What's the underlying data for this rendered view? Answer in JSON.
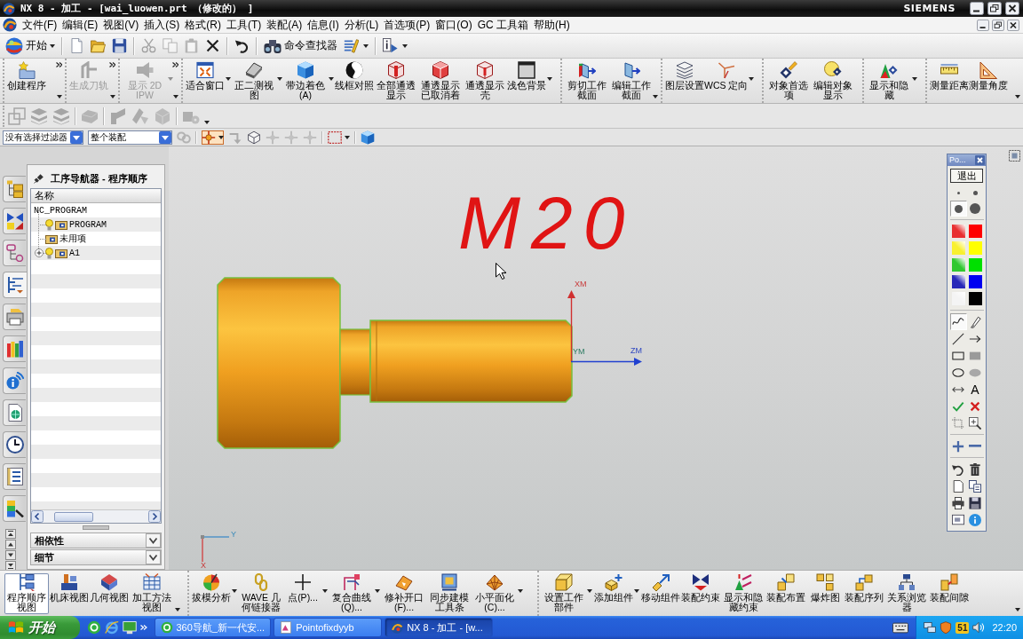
{
  "window": {
    "title": "NX 8 - 加工 - [wai_luowen.prt （修改的） ]",
    "brand": "SIEMENS"
  },
  "menu": [
    "文件(F)",
    "编辑(E)",
    "视图(V)",
    "插入(S)",
    "格式(R)",
    "工具(T)",
    "装配(A)",
    "信息(I)",
    "分析(L)",
    "首选项(P)",
    "窗口(O)",
    "GC 工具箱",
    "帮助(H)"
  ],
  "standard_toolbar": {
    "start": "开始",
    "command_finder": "命令查找器",
    "buttons": [
      {
        "disabled": false,
        "dropdown": false
      },
      {
        "disabled": false,
        "dropdown": false
      },
      {
        "disabled": false,
        "dropdown": false
      },
      {
        "disabled": true,
        "dropdown": false
      },
      {
        "disabled": true,
        "dropdown": false
      },
      {
        "disabled": true,
        "dropdown": false
      },
      {
        "disabled": false,
        "dropdown": false
      },
      {
        "disabled": false,
        "dropdown": false
      },
      {
        "disabled": false,
        "dropdown": true
      },
      {
        "disabled": false,
        "dropdown": true
      }
    ]
  },
  "ribbon": [
    {
      "overflow": true,
      "options": true,
      "buttons": [
        {
          "label": "创建程序",
          "disabled": false,
          "dropdown": false
        }
      ]
    },
    {
      "overflow": true,
      "options": true,
      "buttons": [
        {
          "label": "生成刀轨",
          "disabled": true,
          "dropdown": false
        }
      ]
    },
    {
      "overflow": true,
      "options": true,
      "buttons": [
        {
          "label": "显示 2D IPW",
          "disabled": true,
          "dropdown": true
        }
      ]
    },
    {
      "overflow": false,
      "options": false,
      "buttons": [
        {
          "label": "适合窗口",
          "disabled": false,
          "dropdown": true
        },
        {
          "label": "正二测视图",
          "disabled": false,
          "dropdown": true
        },
        {
          "label": "带边着色(A)",
          "disabled": false,
          "dropdown": true
        },
        {
          "label": "线框对照",
          "disabled": false,
          "dropdown": false
        },
        {
          "label": "全部通透显示",
          "disabled": false,
          "dropdown": false
        },
        {
          "label": "通透显示已取消着",
          "disabled": false,
          "dropdown": false
        },
        {
          "label": "通透显示壳",
          "disabled": false,
          "dropdown": false
        },
        {
          "label": "浅色背景",
          "disabled": false,
          "dropdown": true
        }
      ]
    },
    {
      "overflow": false,
      "options": true,
      "buttons": [
        {
          "label": "剪切工作截面",
          "disabled": false,
          "dropdown": false
        },
        {
          "label": "编辑工作截面",
          "disabled": false,
          "dropdown": false
        }
      ]
    },
    {
      "overflow": false,
      "options": false,
      "buttons": [
        {
          "label": "图层设置",
          "disabled": false,
          "dropdown": false
        },
        {
          "label": "WCS 定向",
          "disabled": false,
          "dropdown": true
        }
      ]
    },
    {
      "overflow": false,
      "options": false,
      "buttons": [
        {
          "label": "对象首选项",
          "disabled": false,
          "dropdown": false
        },
        {
          "label": "编辑对象显示",
          "disabled": false,
          "dropdown": false
        }
      ]
    },
    {
      "overflow": false,
      "options": false,
      "buttons": [
        {
          "label": "显示和隐藏",
          "disabled": false,
          "dropdown": true
        }
      ]
    },
    {
      "overflow": false,
      "options": true,
      "buttons": [
        {
          "label": "测量距离",
          "disabled": false,
          "dropdown": false
        },
        {
          "label": "测量角度",
          "disabled": false,
          "dropdown": false
        }
      ]
    }
  ],
  "view_toolbar": {
    "options": true,
    "buttons": [
      {
        "disabled": true
      },
      {
        "disabled": true
      },
      {
        "disabled": true
      },
      {
        "disabled": true
      },
      {
        "disabled": true
      },
      {
        "disabled": true
      },
      {
        "disabled": true
      },
      {
        "disabled": true
      }
    ]
  },
  "selection_bar": {
    "filter": "没有选择过滤器",
    "scope": "整个装配",
    "tools": [
      {
        "selected": false,
        "disabled": true,
        "dropdown": false
      },
      {
        "selected": true,
        "disabled": false,
        "dropdown": true
      },
      {
        "selected": false,
        "disabled": true,
        "dropdown": false
      },
      {
        "selected": false,
        "disabled": false,
        "dropdown": false
      },
      {
        "selected": false,
        "disabled": true,
        "dropdown": false
      },
      {
        "selected": false,
        "disabled": true,
        "dropdown": false
      },
      {
        "selected": false,
        "disabled": true,
        "dropdown": false
      },
      {
        "selected": false,
        "disabled": false,
        "dropdown": true
      },
      {
        "selected": false,
        "disabled": false,
        "dropdown": false
      }
    ]
  },
  "resource_bar": [
    {
      "selected": false
    },
    {
      "selected": false
    },
    {
      "selected": false
    },
    {
      "selected": true
    },
    {
      "selected": false
    },
    {
      "selected": false
    },
    {
      "selected": false
    },
    {
      "selected": false
    },
    {
      "selected": false
    },
    {
      "selected": false
    },
    {
      "selected": false
    }
  ],
  "navigator": {
    "title": "工序导航器 - 程序顺序",
    "column": "名称",
    "tree": [
      {
        "label": "NC_PROGRAM",
        "kind": "root",
        "collapsed": false,
        "children": [
          {
            "label": "PROGRAM",
            "kind": "program",
            "collapsed": false
          },
          {
            "label": "未用项",
            "kind": "unused",
            "collapsed": false
          },
          {
            "label": "A1",
            "kind": "program",
            "collapsed": true
          }
        ]
      }
    ],
    "sections": [
      {
        "label": "相依性",
        "expanded": false
      },
      {
        "label": "细节",
        "expanded": false
      }
    ]
  },
  "graphics": {
    "annotation": "M20",
    "axes": {
      "x": "XM",
      "y": "YM",
      "z": "ZM"
    },
    "triad": {
      "x": "X",
      "y": "Y"
    }
  },
  "palette": {
    "title": "Po...",
    "exit": "退出",
    "pen_sizes": [
      {
        "selected": false
      },
      {
        "selected": false
      },
      {
        "selected": true
      },
      {
        "selected": false
      }
    ],
    "swatches": [
      {
        "color": "#e83030",
        "kind": "gradient"
      },
      {
        "color": "#ff0000",
        "kind": "solid"
      },
      {
        "color": "#f8f030",
        "kind": "gradient"
      },
      {
        "color": "#ffff00",
        "kind": "solid"
      },
      {
        "color": "#30c830",
        "kind": "gradient"
      },
      {
        "color": "#00e000",
        "kind": "solid"
      },
      {
        "color": "#2828b8",
        "kind": "gradient"
      },
      {
        "color": "#0000f0",
        "kind": "solid"
      },
      {
        "color": "#f4f4f4",
        "kind": "gradient"
      },
      {
        "color": "#000000",
        "kind": "solid"
      }
    ],
    "tool_groups": [
      [
        {
          "kind": "freehand",
          "selected": true
        },
        {
          "kind": "eraser",
          "selected": false
        },
        {
          "kind": "line",
          "selected": false
        },
        {
          "kind": "arrow",
          "selected": false
        },
        {
          "kind": "rectangle",
          "selected": false
        },
        {
          "kind": "filled_rectangle",
          "selected": false
        },
        {
          "kind": "ellipse",
          "selected": false
        },
        {
          "kind": "filled_ellipse",
          "selected": false
        },
        {
          "kind": "dimension",
          "selected": false
        },
        {
          "kind": "text",
          "label": "A",
          "selected": false
        },
        {
          "kind": "accept",
          "selected": false
        },
        {
          "kind": "reject",
          "selected": false
        },
        {
          "kind": "crop",
          "selected": false
        },
        {
          "kind": "zoom",
          "selected": false
        }
      ],
      [
        {
          "kind": "zoom_in",
          "selected": false
        },
        {
          "kind": "zoom_out",
          "selected": false
        }
      ],
      [
        {
          "kind": "undo",
          "selected": false
        },
        {
          "kind": "clear",
          "selected": false
        },
        {
          "kind": "new_page",
          "selected": false
        },
        {
          "kind": "copy",
          "selected": false
        },
        {
          "kind": "print",
          "selected": false
        },
        {
          "kind": "save",
          "selected": false
        },
        {
          "kind": "capture",
          "selected": false
        },
        {
          "kind": "about",
          "selected": false
        }
      ]
    ]
  },
  "bottom_toolbar": [
    {
      "options": true,
      "buttons": [
        {
          "label": "程序顺序视图",
          "selected": true,
          "dropdown": false
        },
        {
          "label": "机床视图",
          "selected": false,
          "dropdown": false
        },
        {
          "label": "几何视图",
          "selected": false,
          "dropdown": false
        },
        {
          "label": "加工方法视图",
          "selected": false,
          "dropdown": false
        }
      ]
    },
    {
      "options": false,
      "buttons": [
        {
          "label": "拔模分析",
          "dropdown": true
        },
        {
          "label": "WAVE 几何链接器",
          "dropdown": false
        },
        {
          "label": "点(P)...",
          "dropdown": true
        },
        {
          "label": "复合曲线(Q)...",
          "dropdown": true
        },
        {
          "label": "修补开口(F)...",
          "dropdown": false
        },
        {
          "label": "同步建模工具条",
          "dropdown": false
        },
        {
          "label": "小平面化(C)...",
          "dropdown": true
        }
      ]
    },
    {
      "options": true,
      "buttons": [
        {
          "label": "设置工作部件",
          "dropdown": true
        },
        {
          "label": "添加组件",
          "dropdown": true
        },
        {
          "label": "移动组件",
          "dropdown": false
        },
        {
          "label": "装配约束",
          "dropdown": false
        },
        {
          "label": "显示和隐藏约束",
          "dropdown": false
        },
        {
          "label": "装配布置",
          "dropdown": false
        },
        {
          "label": "爆炸图",
          "dropdown": false
        },
        {
          "label": "装配序列",
          "dropdown": false
        },
        {
          "label": "关系浏览器",
          "dropdown": false
        },
        {
          "label": "装配间隙",
          "dropdown": false
        }
      ]
    }
  ],
  "taskbar": {
    "start": "开始",
    "tasks": [
      {
        "label": "360导航_新一代安...",
        "selected": false
      },
      {
        "label": "Pointofixdyyb",
        "selected": false
      },
      {
        "label": "NX 8 - 加工 - [w...",
        "selected": true
      }
    ],
    "tray_badge": "51",
    "clock": "22:20"
  }
}
